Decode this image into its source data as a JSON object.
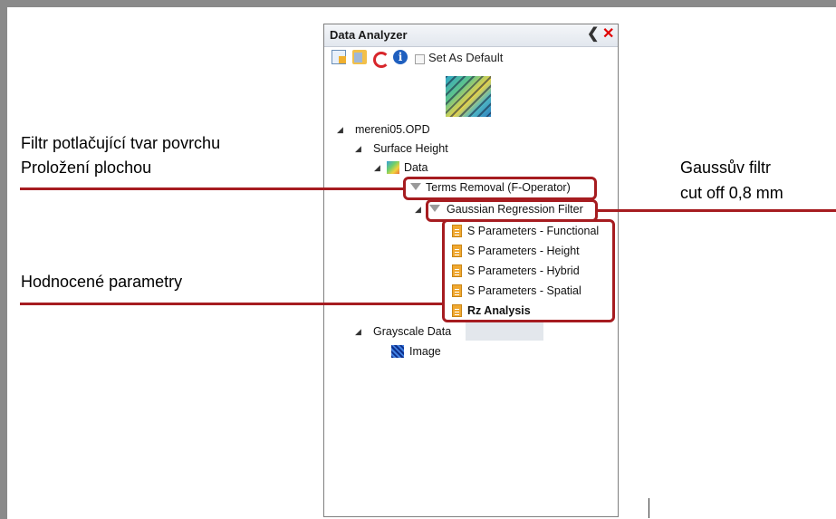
{
  "panel": {
    "title": "Data Analyzer",
    "collapse_icon": "chevron-left-icon",
    "close_icon": "close-icon",
    "toolbar": {
      "icons": [
        "new-document-icon",
        "open-folder-icon",
        "refresh-icon",
        "info-icon"
      ],
      "set_default_label": "Set As Default",
      "set_default_checked": false
    }
  },
  "tree": {
    "root": "mereni05.OPD",
    "surface_height": "Surface Height",
    "data": "Data",
    "terms_removal": "Terms Removal (F-Operator)",
    "gaussian_filter": "Gaussian Regression Filter",
    "s_functional": "S Parameters - Functional",
    "s_height": "S Parameters - Height",
    "s_hybrid": "S Parameters - Hybrid",
    "s_spatial": "S Parameters - Spatial",
    "rz_analysis": "Rz Analysis",
    "grayscale": "Grayscale Data",
    "image": "Image"
  },
  "annotations": {
    "filter_line1": "Filtr potlačující tvar povrchu",
    "filter_line2": "Proložení plochou",
    "gauss_line1": "Gaussův filtr",
    "gauss_line2": "cut off 0,8 mm",
    "params": "Hodnocené parametry"
  },
  "colors": {
    "annotation_red": "#a61c20",
    "close_red": "#e00000",
    "frame_gray": "#8a8a8a"
  }
}
